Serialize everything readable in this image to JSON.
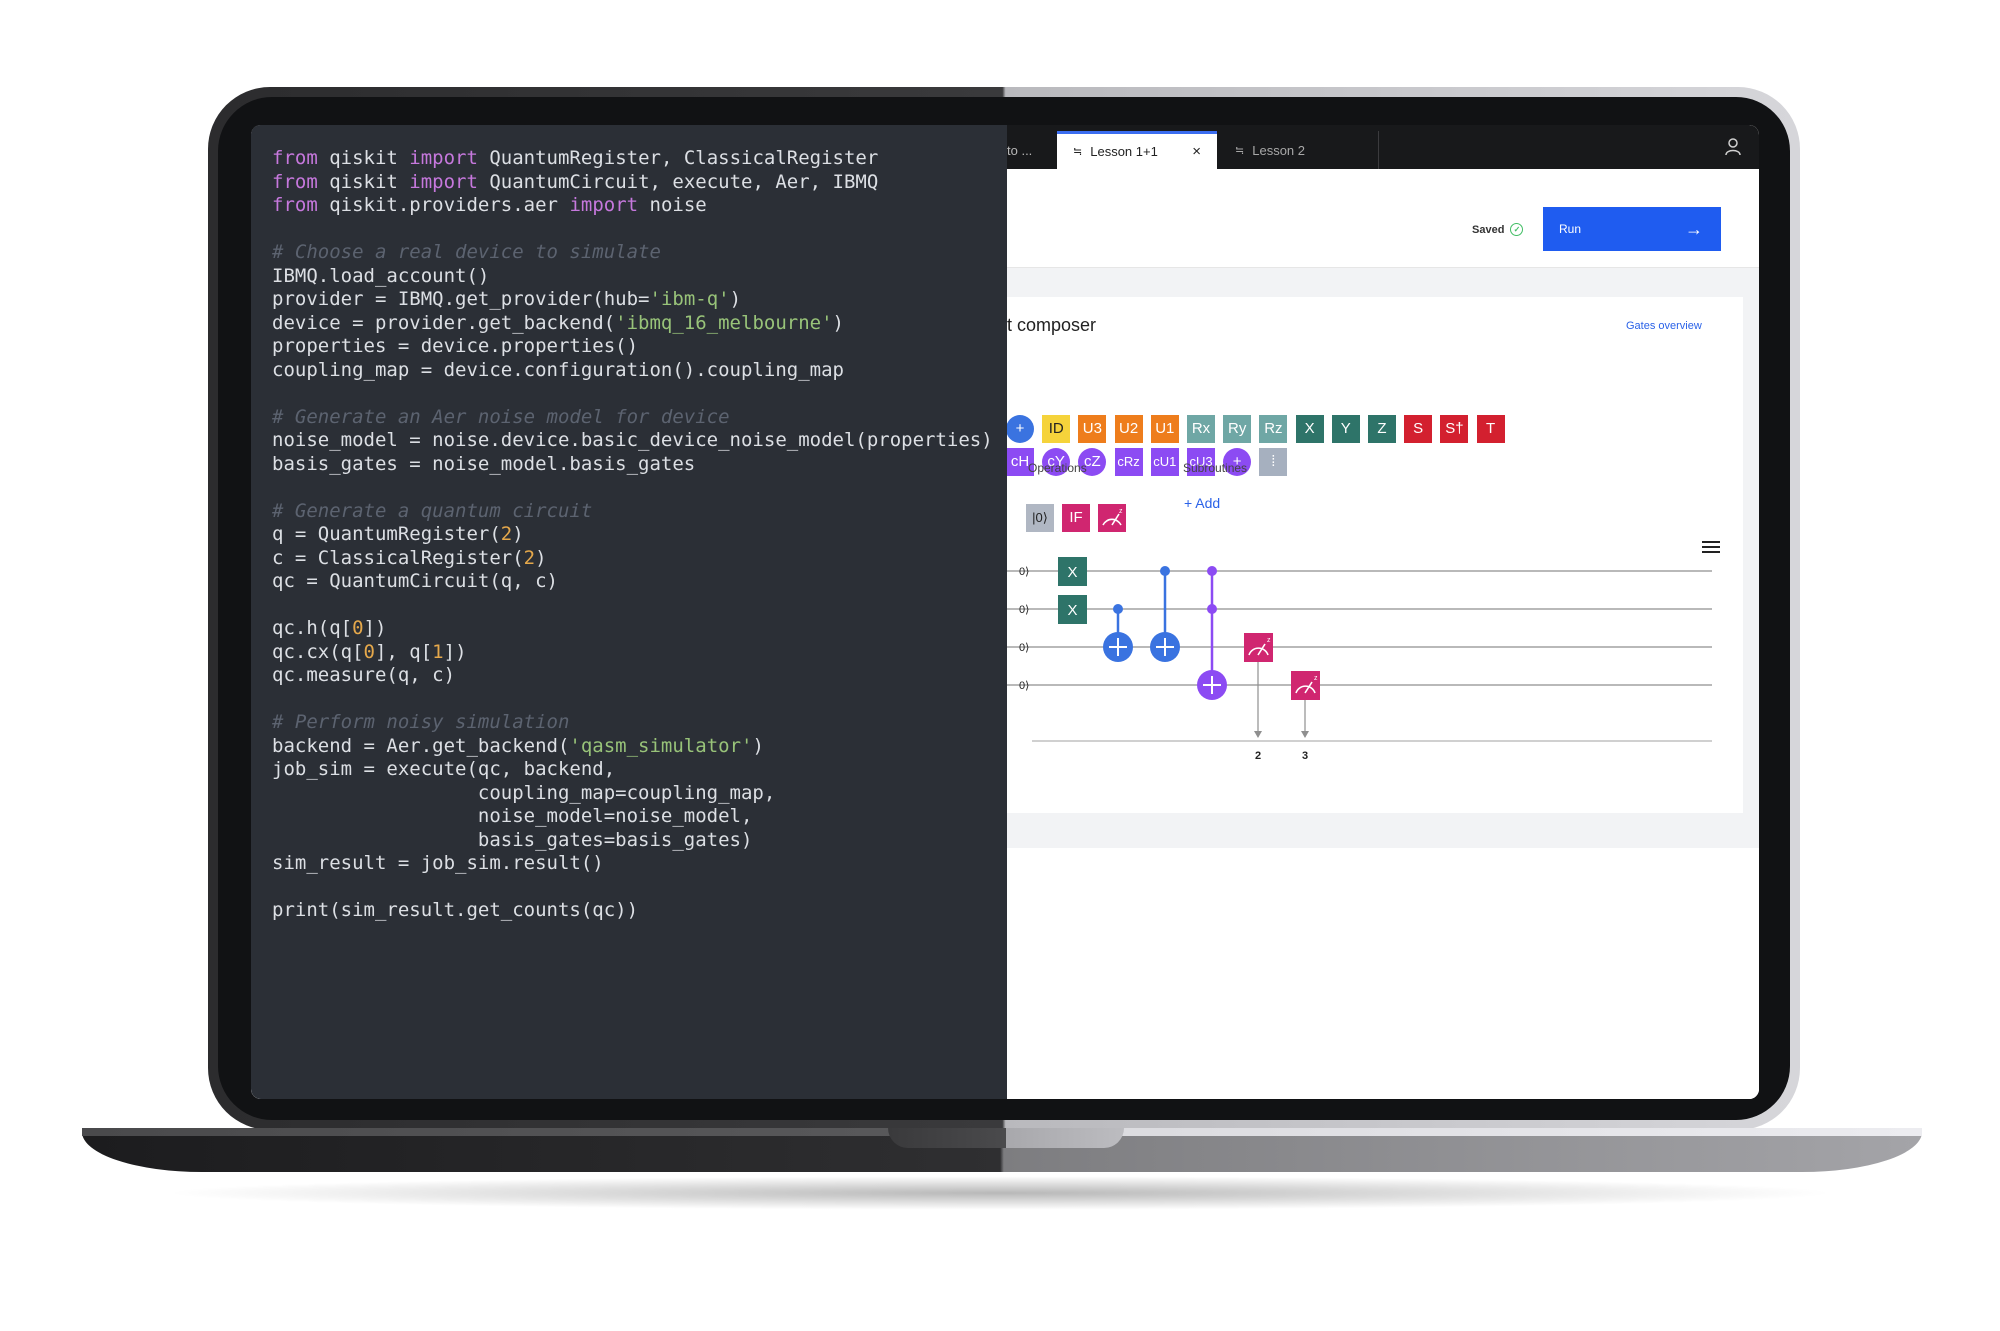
{
  "editor": {
    "lines": [
      [
        {
          "t": "from",
          "c": "kw"
        },
        {
          "t": " qiskit "
        },
        {
          "t": "import",
          "c": "kw"
        },
        {
          "t": " QuantumRegister, ClassicalRegister"
        }
      ],
      [
        {
          "t": "from",
          "c": "kw"
        },
        {
          "t": " qiskit "
        },
        {
          "t": "import",
          "c": "kw"
        },
        {
          "t": " QuantumCircuit, execute, Aer, IBMQ"
        }
      ],
      [
        {
          "t": "from",
          "c": "kw"
        },
        {
          "t": " qiskit.providers.aer "
        },
        {
          "t": "import",
          "c": "kw"
        },
        {
          "t": " noise"
        }
      ],
      [],
      [
        {
          "t": "# Choose a real device to simulate",
          "c": "com"
        }
      ],
      [
        {
          "t": "IBMQ.load_account()"
        }
      ],
      [
        {
          "t": "provider = IBMQ.get_provider(hub="
        },
        {
          "t": "'ibm-q'",
          "c": "str"
        },
        {
          "t": ")"
        }
      ],
      [
        {
          "t": "device = provider.get_backend("
        },
        {
          "t": "'ibmq_16_melbourne'",
          "c": "str"
        },
        {
          "t": ")"
        }
      ],
      [
        {
          "t": "properties = device.properties()"
        }
      ],
      [
        {
          "t": "coupling_map = device.configuration().coupling_map"
        }
      ],
      [],
      [
        {
          "t": "# Generate an Aer noise model for device",
          "c": "com"
        }
      ],
      [
        {
          "t": "noise_model = noise.device.basic_device_noise_model(properties)"
        }
      ],
      [
        {
          "t": "basis_gates = noise_model.basis_gates"
        }
      ],
      [],
      [
        {
          "t": "# Generate a quantum circuit",
          "c": "com"
        }
      ],
      [
        {
          "t": "q = QuantumRegister("
        },
        {
          "t": "2",
          "c": "num"
        },
        {
          "t": ")"
        }
      ],
      [
        {
          "t": "c = ClassicalRegister("
        },
        {
          "t": "2",
          "c": "num"
        },
        {
          "t": ")"
        }
      ],
      [
        {
          "t": "qc = QuantumCircuit(q, c)"
        }
      ],
      [],
      [
        {
          "t": "qc.h(q["
        },
        {
          "t": "0",
          "c": "num"
        },
        {
          "t": "])"
        }
      ],
      [
        {
          "t": "qc.cx(q["
        },
        {
          "t": "0",
          "c": "num"
        },
        {
          "t": "], q["
        },
        {
          "t": "1",
          "c": "num"
        },
        {
          "t": "])"
        }
      ],
      [
        {
          "t": "qc.measure(q, c)"
        }
      ],
      [],
      [
        {
          "t": "# Perform noisy simulation",
          "c": "com"
        }
      ],
      [
        {
          "t": "backend = Aer.get_backend("
        },
        {
          "t": "'qasm_simulator'",
          "c": "str"
        },
        {
          "t": ")"
        }
      ],
      [
        {
          "t": "job_sim = execute(qc, backend,"
        }
      ],
      [
        {
          "t": "                  coupling_map=coupling_map,"
        }
      ],
      [
        {
          "t": "                  noise_model=noise_model,"
        }
      ],
      [
        {
          "t": "                  basis_gates=basis_gates)"
        }
      ],
      [
        {
          "t": "sim_result = job_sim.result()"
        }
      ],
      [],
      [
        {
          "t": "print(sim_result.get_counts(qc))"
        }
      ]
    ]
  },
  "tabs": {
    "prev_label": "to ...",
    "lesson1_label": "Lesson 1+1",
    "lesson1_close": "×",
    "lesson2_label": "Lesson 2",
    "tab_icon": "≒"
  },
  "toolbar": {
    "saved_label": "Saved",
    "saved_check": "✓",
    "run_label": "Run",
    "run_arrow": "→"
  },
  "composer": {
    "title": "t composer",
    "gates_overview": "Gates overview",
    "gates_row1": [
      {
        "label": "+",
        "color": "#3a73e0",
        "shape": "circle"
      },
      {
        "label": "ID",
        "color": "#f5d33b",
        "shape": "square",
        "text": "#222"
      },
      {
        "label": "U3",
        "color": "#ee7d1c",
        "shape": "square"
      },
      {
        "label": "U2",
        "color": "#ee7d1c",
        "shape": "square"
      },
      {
        "label": "U1",
        "color": "#ee7d1c",
        "shape": "square"
      },
      {
        "label": "Rx",
        "color": "#6fa7a5",
        "shape": "square"
      },
      {
        "label": "Ry",
        "color": "#6fa7a5",
        "shape": "square"
      },
      {
        "label": "Rz",
        "color": "#6fa7a5",
        "shape": "square"
      },
      {
        "label": "X",
        "color": "#2e7469",
        "shape": "square"
      },
      {
        "label": "Y",
        "color": "#2e7469",
        "shape": "square"
      },
      {
        "label": "Z",
        "color": "#2e7469",
        "shape": "square"
      },
      {
        "label": "S",
        "color": "#d3202f",
        "shape": "square"
      },
      {
        "label": "S†",
        "color": "#d3202f",
        "shape": "square"
      },
      {
        "label": "T",
        "color": "#d3202f",
        "shape": "square"
      }
    ],
    "gates_row2": [
      {
        "label": "cH",
        "color": "#8c4bf3",
        "shape": "square"
      },
      {
        "label": "cY",
        "color": "#8c4bf3",
        "shape": "circle"
      },
      {
        "label": "cZ",
        "color": "#8c4bf3",
        "shape": "circle"
      },
      {
        "label": "cRz",
        "color": "#8c4bf3",
        "shape": "square"
      },
      {
        "label": "cU1",
        "color": "#8c4bf3",
        "shape": "square"
      },
      {
        "label": "cU3",
        "color": "#8c4bf3",
        "shape": "square"
      },
      {
        "label": "+",
        "color": "#8c4bf3",
        "shape": "circle"
      },
      {
        "label": "⁞",
        "color": "#a6b0bf",
        "shape": "square"
      }
    ],
    "operations_label": "Operations",
    "subroutines_label": "Subroutines",
    "operations": [
      {
        "label": "|0⟩",
        "color": "#b0b7c3",
        "text": "#222"
      },
      {
        "label": "IF",
        "color": "#d02670",
        "text": "#fff"
      },
      {
        "label": "measure",
        "color": "#d02670",
        "text": "#fff"
      }
    ],
    "add_subroutine": "+ Add"
  },
  "circuit": {
    "qubit_labels": [
      "0⟩",
      "0⟩",
      "0⟩",
      "0⟩"
    ],
    "x_gate_label": "X",
    "classical_bits": [
      "2",
      "3"
    ]
  },
  "colors": {
    "editor_bg": "#2b2f36",
    "run_button": "#1f5cf0",
    "cnot_blue": "#3a73e0",
    "cnot_purple": "#8c4bf3",
    "x_gate": "#2e7469",
    "measure": "#d02670"
  }
}
